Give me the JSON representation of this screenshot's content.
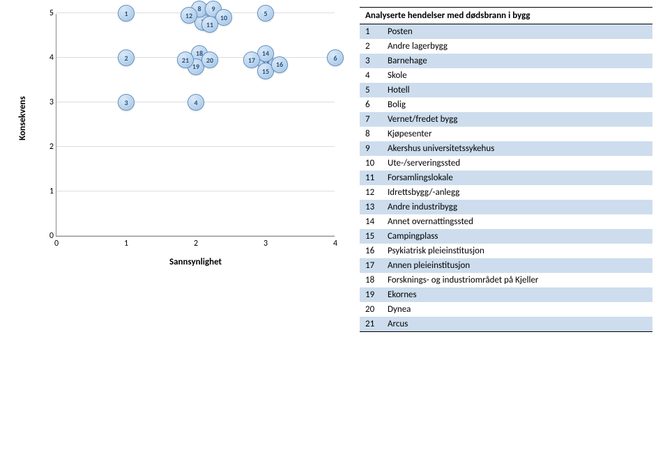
{
  "chart_data": {
    "type": "scatter",
    "xlabel": "Sannsynlighet",
    "ylabel": "Konsekvens",
    "xlim": [
      0,
      4
    ],
    "ylim": [
      0,
      5
    ],
    "x_ticks": [
      0,
      1,
      2,
      3,
      4
    ],
    "y_ticks": [
      0,
      1,
      2,
      3,
      4,
      5
    ],
    "points": [
      {
        "id": 1,
        "x": 1.0,
        "y": 5.0
      },
      {
        "id": 2,
        "x": 1.0,
        "y": 4.0
      },
      {
        "id": 3,
        "x": 1.0,
        "y": 3.0
      },
      {
        "id": 4,
        "x": 2.0,
        "y": 3.0
      },
      {
        "id": 5,
        "x": 3.0,
        "y": 5.0
      },
      {
        "id": 6,
        "x": 4.0,
        "y": 4.0
      },
      {
        "id": 7,
        "x": 2.1,
        "y": 4.8
      },
      {
        "id": 8,
        "x": 2.05,
        "y": 5.1
      },
      {
        "id": 9,
        "x": 2.25,
        "y": 5.1
      },
      {
        "id": 10,
        "x": 2.4,
        "y": 4.9
      },
      {
        "id": 11,
        "x": 2.2,
        "y": 4.75
      },
      {
        "id": 12,
        "x": 1.9,
        "y": 4.95
      },
      {
        "id": 13,
        "x": 3.0,
        "y": 3.9
      },
      {
        "id": 14,
        "x": 3.0,
        "y": 4.1
      },
      {
        "id": 15,
        "x": 3.0,
        "y": 3.7
      },
      {
        "id": 16,
        "x": 3.2,
        "y": 3.85
      },
      {
        "id": 17,
        "x": 2.8,
        "y": 3.95
      },
      {
        "id": 18,
        "x": 2.05,
        "y": 4.1
      },
      {
        "id": 19,
        "x": 2.0,
        "y": 3.8
      },
      {
        "id": 20,
        "x": 2.2,
        "y": 3.95
      },
      {
        "id": 21,
        "x": 1.85,
        "y": 3.95
      }
    ]
  },
  "table": {
    "header": "Analyserte hendelser med dødsbrann i bygg",
    "rows": [
      {
        "n": 1,
        "label": "Posten"
      },
      {
        "n": 2,
        "label": "Andre lagerbygg"
      },
      {
        "n": 3,
        "label": "Barnehage"
      },
      {
        "n": 4,
        "label": "Skole"
      },
      {
        "n": 5,
        "label": "Hotell"
      },
      {
        "n": 6,
        "label": "Bolig"
      },
      {
        "n": 7,
        "label": "Vernet/fredet bygg"
      },
      {
        "n": 8,
        "label": "Kjøpesenter"
      },
      {
        "n": 9,
        "label": "Akershus universitetssykehus"
      },
      {
        "n": 10,
        "label": "Ute-/serveringssted"
      },
      {
        "n": 11,
        "label": "Forsamlingslokale"
      },
      {
        "n": 12,
        "label": "Idrettsbygg/-anlegg"
      },
      {
        "n": 13,
        "label": "Andre industribygg"
      },
      {
        "n": 14,
        "label": "Annet overnattingssted"
      },
      {
        "n": 15,
        "label": "Campingplass"
      },
      {
        "n": 16,
        "label": "Psykiatrisk pleieinstitusjon"
      },
      {
        "n": 17,
        "label": "Annen pleieinstitusjon"
      },
      {
        "n": 18,
        "label": "Forsknings- og industriområdet på Kjeller"
      },
      {
        "n": 19,
        "label": "Ekornes"
      },
      {
        "n": 20,
        "label": "Dynea"
      },
      {
        "n": 21,
        "label": "Arcus"
      }
    ]
  }
}
